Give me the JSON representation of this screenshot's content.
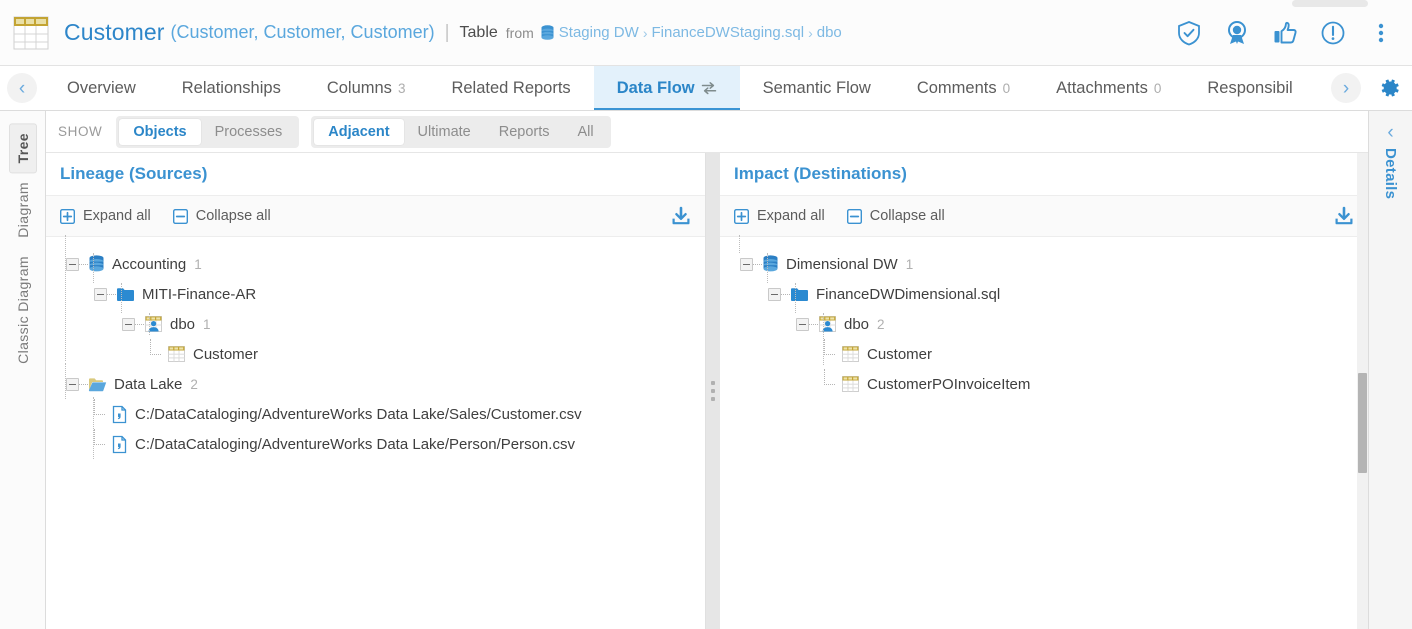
{
  "header": {
    "table_icon": "table-icon",
    "title": "Customer",
    "aliases": "(Customer, Customer, Customer)",
    "divider": "|",
    "object_type": "Table",
    "from_label": "from",
    "breadcrumb": {
      "db_icon": "database-icon",
      "database": "Staging DW",
      "sep1": "›",
      "file": "FinanceDWStaging.sql",
      "sep2": "›",
      "schema": "dbo"
    },
    "actions": [
      {
        "name": "certified-shield-icon",
        "label": "Certified"
      },
      {
        "name": "award-badge-icon",
        "label": "Endorsed"
      },
      {
        "name": "thumbs-up-icon",
        "label": "Like"
      },
      {
        "name": "warning-circle-icon",
        "label": "Warning"
      },
      {
        "name": "more-vertical-icon",
        "label": "More"
      }
    ]
  },
  "tabs": {
    "prev_arrow": "‹",
    "next_arrow": "›",
    "items": [
      {
        "label": "Overview",
        "count": "",
        "active": false,
        "icon": ""
      },
      {
        "label": "Relationships",
        "count": "",
        "active": false,
        "icon": ""
      },
      {
        "label": "Columns",
        "count": "3",
        "active": false,
        "icon": ""
      },
      {
        "label": "Related Reports",
        "count": "",
        "active": false,
        "icon": ""
      },
      {
        "label": "Data Flow",
        "count": "",
        "active": true,
        "icon": "data-flow-icon"
      },
      {
        "label": "Semantic Flow",
        "count": "",
        "active": false,
        "icon": ""
      },
      {
        "label": "Comments",
        "count": "0",
        "active": false,
        "icon": ""
      },
      {
        "label": "Attachments",
        "count": "0",
        "active": false,
        "icon": ""
      },
      {
        "label": "Responsibil",
        "count": "",
        "active": false,
        "icon": ""
      }
    ],
    "settings_icon": "gear-icon"
  },
  "left_rail": {
    "items": [
      {
        "label": "Tree",
        "active": true
      },
      {
        "label": "Diagram",
        "active": false
      },
      {
        "label": "Classic Diagram",
        "active": false
      }
    ]
  },
  "right_rail": {
    "chevron": "‹",
    "label": "Details"
  },
  "showbar": {
    "label": "SHOW",
    "group_objects": [
      {
        "label": "Objects",
        "selected": true
      },
      {
        "label": "Processes",
        "selected": false
      }
    ],
    "group_scope": [
      {
        "label": "Adjacent",
        "selected": true
      },
      {
        "label": "Ultimate",
        "selected": false
      },
      {
        "label": "Reports",
        "selected": false
      },
      {
        "label": "All",
        "selected": false
      }
    ]
  },
  "lineage": {
    "title": "Lineage (Sources)",
    "expand_label": "Expand all",
    "collapse_label": "Collapse all",
    "download_icon": "download-icon",
    "nodes": [
      {
        "depth": 0,
        "icon": "database-icon",
        "name": "Accounting",
        "count": "1",
        "expandable": true
      },
      {
        "depth": 1,
        "icon": "folder-icon",
        "name": "MITI-Finance-AR",
        "count": "",
        "expandable": true
      },
      {
        "depth": 2,
        "icon": "schema-icon",
        "name": "dbo",
        "count": "1",
        "expandable": true
      },
      {
        "depth": 3,
        "icon": "table-icon",
        "name": "Customer",
        "count": "",
        "expandable": false
      },
      {
        "depth": 0,
        "icon": "open-folder-icon",
        "name": "Data Lake",
        "count": "2",
        "expandable": true
      },
      {
        "depth": 1,
        "icon": "csv-file-icon",
        "name": "C:/DataCataloging/AdventureWorks Data Lake/Sales/Customer.csv",
        "count": "",
        "expandable": false
      },
      {
        "depth": 1,
        "icon": "csv-file-icon",
        "name": "C:/DataCataloging/AdventureWorks Data Lake/Person/Person.csv",
        "count": "",
        "expandable": false
      }
    ]
  },
  "impact": {
    "title": "Impact (Destinations)",
    "expand_label": "Expand all",
    "collapse_label": "Collapse all",
    "download_icon": "download-icon",
    "nodes": [
      {
        "depth": 0,
        "icon": "database-icon",
        "name": "Dimensional DW",
        "count": "1",
        "expandable": true
      },
      {
        "depth": 1,
        "icon": "folder-icon",
        "name": "FinanceDWDimensional.sql",
        "count": "",
        "expandable": true
      },
      {
        "depth": 2,
        "icon": "schema-icon",
        "name": "dbo",
        "count": "2",
        "expandable": true
      },
      {
        "depth": 3,
        "icon": "table-icon",
        "name": "Customer",
        "count": "",
        "expandable": false
      },
      {
        "depth": 3,
        "icon": "table-icon",
        "name": "CustomerPOInvoiceItem",
        "count": "",
        "expandable": false
      }
    ]
  },
  "colors": {
    "accent": "#3b92d1",
    "accent_light": "#e3f1fb",
    "table_gold": "#c3a433",
    "folder_blue": "#2b8ad1",
    "text": "#3f3f3f",
    "muted": "#b0b0b0"
  }
}
